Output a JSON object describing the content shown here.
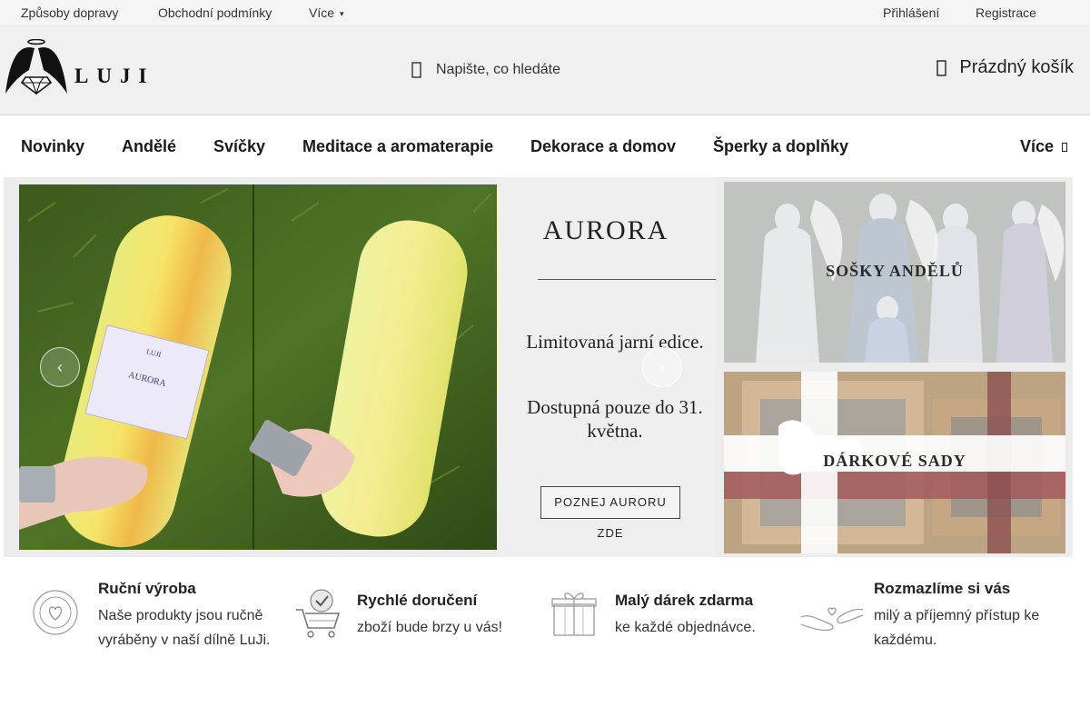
{
  "topbar": {
    "links": [
      "Způsoby dopravy",
      "Obchodní podmínky",
      "Více"
    ],
    "more_caret": "▾",
    "login": "Přihlášení",
    "register": "Registrace"
  },
  "header": {
    "logo_text": "LUJI",
    "search_placeholder": "Napište, co hledáte",
    "search_icon": "search-icon",
    "cart_label": "Prázdný košík",
    "cart_icon": "cart-icon"
  },
  "nav": {
    "items": [
      "Novinky",
      "Andělé",
      "Svíčky",
      "Meditace a aromaterapie",
      "Dekorace a domov",
      "Šperky a doplňky"
    ],
    "more": "Více"
  },
  "banner": {
    "slide": {
      "title": "AURORA",
      "line1": "Limitovaná jarní edice.",
      "line2": "Dostupná pouze do 31. května.",
      "button": "POZNEJ AURORU ZDE",
      "candle_label_brand": "LUJI",
      "candle_label_line": "AURORA"
    },
    "prev_arrow": "‹",
    "next_arrow": "›",
    "promos": [
      {
        "label": "SOŠKY ANDĚLŮ"
      },
      {
        "label": "DÁRKOVÉ SADY"
      }
    ]
  },
  "features": [
    {
      "icon": "handmade-badge-icon",
      "title": "Ruční výroba",
      "text": "Naše produkty jsou ručně vyráběny v naší dílně LuJi."
    },
    {
      "icon": "shopping-cart-check-icon",
      "title": "Rychlé doručení",
      "text": "zboží bude brzy u vás!"
    },
    {
      "icon": "gift-box-icon",
      "title": "Malý dárek zdarma",
      "text": "ke každé objednávce."
    },
    {
      "icon": "heart-hands-icon",
      "title": "Rozmazlíme si vás",
      "text": "milý a příjemný přístup ke každému."
    }
  ],
  "colors": {
    "topbar_bg": "#f5f5f5",
    "header_bg": "#f0f0f0",
    "text": "#1a1a1a"
  }
}
